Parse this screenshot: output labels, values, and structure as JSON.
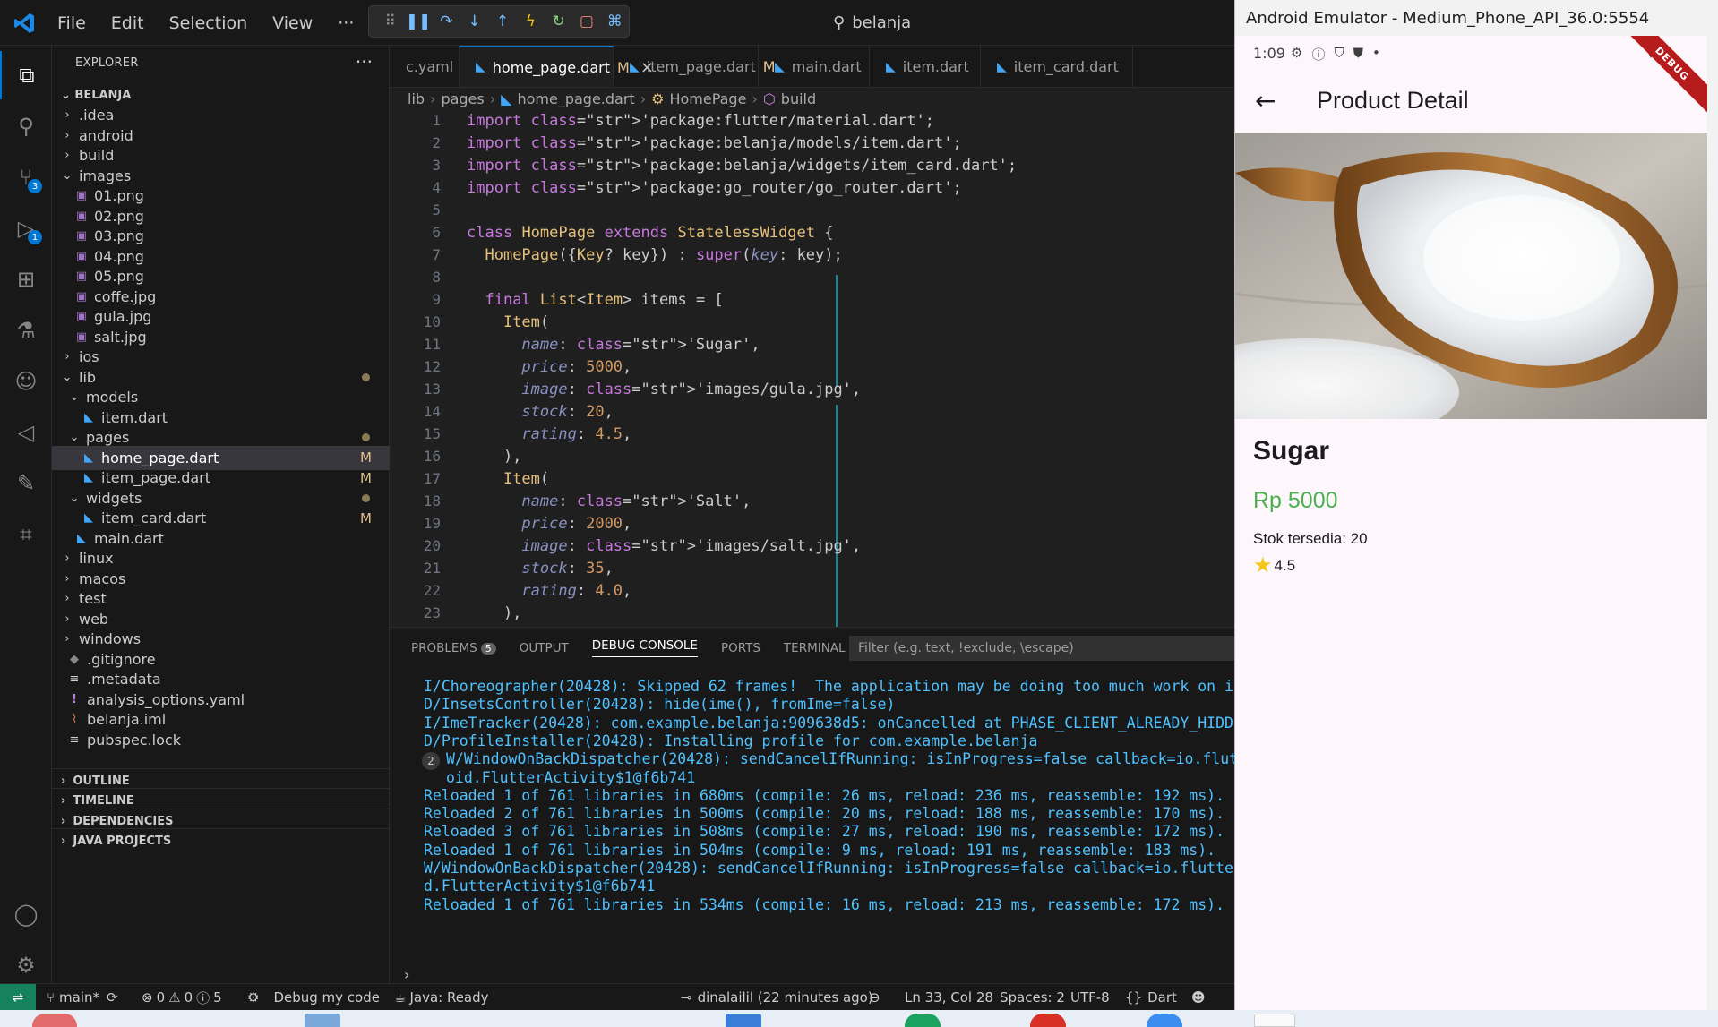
{
  "titlebar": {
    "menu": [
      "File",
      "Edit",
      "Selection",
      "View",
      "···"
    ],
    "search": "belanja"
  },
  "activity": {
    "source_control_badge": "3",
    "run_badge": "1"
  },
  "explorer": {
    "title": "EXPLORER",
    "project": "BELANJA",
    "tree": [
      {
        "label": ".idea",
        "kind": "folder",
        "indent": 0
      },
      {
        "label": "android",
        "kind": "folder",
        "indent": 0
      },
      {
        "label": "build",
        "kind": "folder",
        "indent": 0
      },
      {
        "label": "images",
        "kind": "folder-open",
        "indent": 0
      },
      {
        "label": "01.png",
        "kind": "img",
        "indent": 1
      },
      {
        "label": "02.png",
        "kind": "img",
        "indent": 1
      },
      {
        "label": "03.png",
        "kind": "img",
        "indent": 1
      },
      {
        "label": "04.png",
        "kind": "img",
        "indent": 1
      },
      {
        "label": "05.png",
        "kind": "img",
        "indent": 1
      },
      {
        "label": "coffe.jpg",
        "kind": "img",
        "indent": 1
      },
      {
        "label": "gula.jpg",
        "kind": "img",
        "indent": 1
      },
      {
        "label": "salt.jpg",
        "kind": "img",
        "indent": 1
      },
      {
        "label": "ios",
        "kind": "folder",
        "indent": 0
      },
      {
        "label": "lib",
        "kind": "folder-open",
        "indent": 0,
        "dot": true
      },
      {
        "label": "models",
        "kind": "folder-open",
        "indent": 1
      },
      {
        "label": "item.dart",
        "kind": "dart",
        "indent": 2
      },
      {
        "label": "pages",
        "kind": "folder-open",
        "indent": 1,
        "dot": true
      },
      {
        "label": "home_page.dart",
        "kind": "dart",
        "indent": 2,
        "mod": "M",
        "selected": true
      },
      {
        "label": "item_page.dart",
        "kind": "dart",
        "indent": 2,
        "mod": "M"
      },
      {
        "label": "widgets",
        "kind": "folder-open",
        "indent": 1,
        "dot": true
      },
      {
        "label": "item_card.dart",
        "kind": "dart",
        "indent": 2,
        "mod": "M"
      },
      {
        "label": "main.dart",
        "kind": "dart",
        "indent": 1
      },
      {
        "label": "linux",
        "kind": "folder",
        "indent": 0
      },
      {
        "label": "macos",
        "kind": "folder",
        "indent": 0
      },
      {
        "label": "test",
        "kind": "folder",
        "indent": 0
      },
      {
        "label": "web",
        "kind": "folder",
        "indent": 0
      },
      {
        "label": "windows",
        "kind": "folder",
        "indent": 0
      },
      {
        "label": ".gitignore",
        "kind": "git",
        "indent": 0
      },
      {
        "label": ".metadata",
        "kind": "lines",
        "indent": 0
      },
      {
        "label": "analysis_options.yaml",
        "kind": "yaml",
        "indent": 0
      },
      {
        "label": "belanja.iml",
        "kind": "rss",
        "indent": 0
      },
      {
        "label": "pubspec.lock",
        "kind": "lines",
        "indent": 0
      }
    ],
    "sections": [
      "OUTLINE",
      "TIMELINE",
      "DEPENDENCIES",
      "JAVA PROJECTS"
    ]
  },
  "tabs": [
    {
      "label": "c.yaml",
      "dart": false
    },
    {
      "label": "home_page.dart",
      "mod": "M",
      "active": true,
      "dart": true
    },
    {
      "label": "item_page.dart",
      "mod": "M",
      "dart": true
    },
    {
      "label": "main.dart",
      "dart": true
    },
    {
      "label": "item.dart",
      "dart": true
    },
    {
      "label": "item_card.dart",
      "dart": true
    }
  ],
  "breadcrumb": [
    "lib",
    "pages",
    "home_page.dart",
    "HomePage",
    "build"
  ],
  "code_lines": [
    {
      "n": "1",
      "t": "import 'package:flutter/material.dart';"
    },
    {
      "n": "2",
      "t": "import 'package:belanja/models/item.dart';"
    },
    {
      "n": "3",
      "t": "import 'package:belanja/widgets/item_card.dart';"
    },
    {
      "n": "4",
      "t": "import 'package:go_router/go_router.dart';"
    },
    {
      "n": "5",
      "t": ""
    },
    {
      "n": "6",
      "t": "class HomePage extends StatelessWidget {"
    },
    {
      "n": "7",
      "t": "  HomePage({Key? key}) : super(key: key);"
    },
    {
      "n": "8",
      "t": ""
    },
    {
      "n": "9",
      "t": "  final List<Item> items = ["
    },
    {
      "n": "10",
      "t": "    Item("
    },
    {
      "n": "11",
      "t": "      name: 'Sugar',"
    },
    {
      "n": "12",
      "t": "      price: 5000,"
    },
    {
      "n": "13",
      "t": "      image: 'images/gula.jpg',"
    },
    {
      "n": "14",
      "t": "      stock: 20,"
    },
    {
      "n": "15",
      "t": "      rating: 4.5,"
    },
    {
      "n": "16",
      "t": "    ),"
    },
    {
      "n": "17",
      "t": "    Item("
    },
    {
      "n": "18",
      "t": "      name: 'Salt',"
    },
    {
      "n": "19",
      "t": "      price: 2000,"
    },
    {
      "n": "20",
      "t": "      image: 'images/salt.jpg',"
    },
    {
      "n": "21",
      "t": "      stock: 35,"
    },
    {
      "n": "22",
      "t": "      rating: 4.0,"
    },
    {
      "n": "23",
      "t": "    ),"
    }
  ],
  "panel": {
    "tabs": [
      "PROBLEMS",
      "OUTPUT",
      "DEBUG CONSOLE",
      "PORTS",
      "TERMINAL"
    ],
    "problems_count": "5",
    "filter_placeholder": "Filter (e.g. text, !exclude, \\escape)",
    "console_lines": [
      "I/Choreographer(20428): Skipped 62 frames!  The application may be doing too much work on its",
      "D/InsetsController(20428): hide(ime(), fromIme=false)",
      "I/ImeTracker(20428): com.example.belanja:909638d5: onCancelled at PHASE_CLIENT_ALREADY_HIDDEN",
      "D/ProfileInstaller(20428): Installing profile for com.example.belanja",
      "W/WindowOnBackDispatcher(20428): sendCancelIfRunning: isInProgress=false callback=io.flutte",
      "oid.FlutterActivity$1@f6b741",
      "Reloaded 1 of 761 libraries in 680ms (compile: 26 ms, reload: 236 ms, reassemble: 192 ms).",
      "Reloaded 2 of 761 libraries in 500ms (compile: 20 ms, reload: 188 ms, reassemble: 170 ms).",
      "Reloaded 3 of 761 libraries in 508ms (compile: 27 ms, reload: 190 ms, reassemble: 172 ms).",
      "Reloaded 1 of 761 libraries in 504ms (compile: 9 ms, reload: 191 ms, reassemble: 183 ms).",
      "W/WindowOnBackDispatcher(20428): sendCancelIfRunning: isInProgress=false callback=io.flutter.e",
      "d.FlutterActivity$1@f6b741",
      "Reloaded 1 of 761 libraries in 534ms (compile: 16 ms, reload: 213 ms, reassemble: 172 ms)."
    ],
    "repeat_count": "2"
  },
  "statusbar": {
    "branch": "main*",
    "errors": "0",
    "warnings": "0",
    "infos": "5",
    "debug": "Debug my code",
    "java": "Java: Ready",
    "blame": "dinalailil (22 minutes ago)",
    "position": "Ln 33, Col 28",
    "spaces": "Spaces: 2",
    "encoding": "UTF-8",
    "language": "Dart"
  },
  "emulator": {
    "window_title": "Android Emulator - Medium_Phone_API_36.0:5554",
    "time": "1:09",
    "debug_ribbon": "DEBUG",
    "page_title": "Product Detail",
    "product": {
      "name": "Sugar",
      "price": "Rp 5000",
      "stock": "Stok tersedia: 20",
      "rating": "4.5"
    }
  }
}
